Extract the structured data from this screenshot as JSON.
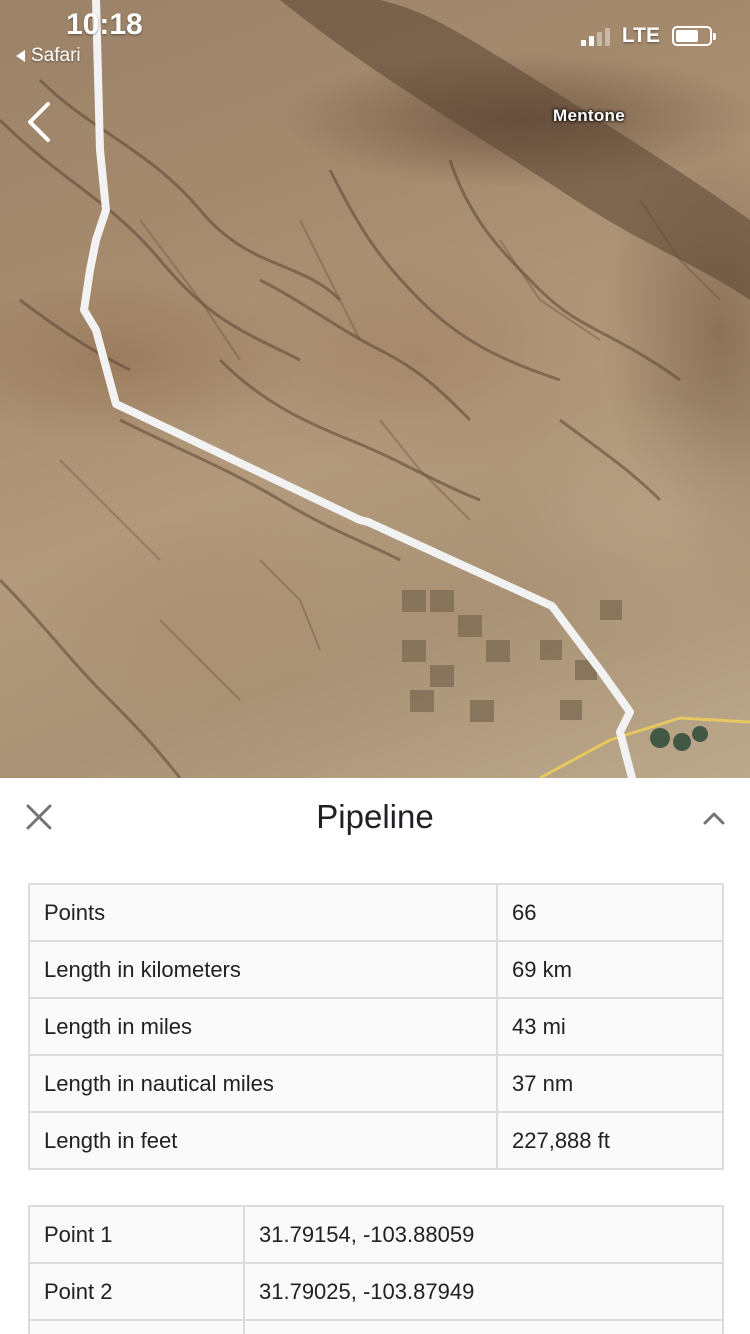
{
  "status_bar": {
    "time": "10:18",
    "back_app": "Safari",
    "network": "LTE"
  },
  "map": {
    "place_labels": [
      "Mentone"
    ],
    "route_color": "#f2f2f2"
  },
  "panel": {
    "title": "Pipeline",
    "stats": [
      {
        "label": "Points",
        "value": "66"
      },
      {
        "label": "Length in kilometers",
        "value": "69 km"
      },
      {
        "label": "Length in miles",
        "value": "43 mi"
      },
      {
        "label": "Length in nautical miles",
        "value": "37 nm"
      },
      {
        "label": "Length in feet",
        "value": "227,888 ft"
      }
    ],
    "points": [
      {
        "label": "Point 1",
        "value": "31.79154, -103.88059"
      },
      {
        "label": "Point 2",
        "value": "31.79025, -103.87949"
      }
    ]
  },
  "icons": {
    "back": "chevron-left-icon",
    "close": "close-icon",
    "collapse": "chevron-up-icon"
  }
}
